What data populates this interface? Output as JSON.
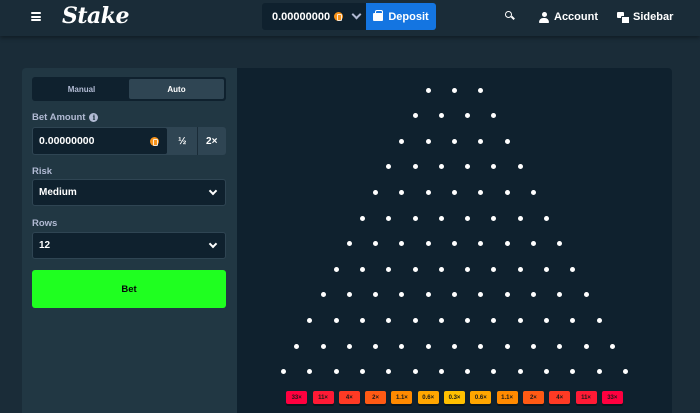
{
  "header": {
    "logo": "Stake",
    "balance": "0.00000000",
    "deposit_label": "Deposit",
    "account_label": "Account",
    "sidebar_label": "Sidebar",
    "icons": [
      "menu-icon",
      "coin-icon",
      "chevron-down-icon",
      "wallet-icon",
      "search-icon",
      "user-icon",
      "chat-icon"
    ]
  },
  "controls": {
    "tabs": [
      {
        "label": "Manual",
        "active": false
      },
      {
        "label": "Auto",
        "active": true
      }
    ],
    "bet_amount_label": "Bet Amount",
    "bet_amount_value": "0.00000000",
    "half_label": "½",
    "double_label": "2×",
    "risk_label": "Risk",
    "risk_value": "Medium",
    "rows_label": "Rows",
    "rows_value": "12",
    "bet_button_label": "Bet"
  },
  "board": {
    "rows": 12,
    "multipliers": [
      "33×",
      "11×",
      "4×",
      "2×",
      "1.1×",
      "0.6×",
      "0.3×",
      "0.6×",
      "1.1×",
      "2×",
      "4×",
      "11×",
      "33×"
    ],
    "bucket_colors": [
      "#ff003f",
      "#ff1a35",
      "#ff3a24",
      "#ff5a14",
      "#ff8a00",
      "#ffa600",
      "#ffc000",
      "#ffa600",
      "#ff8a00",
      "#ff5a14",
      "#ff3a24",
      "#ff1a35",
      "#ff003f"
    ]
  },
  "colors": {
    "background": "#1a2c38",
    "panel": "#213743",
    "board": "#0f212e",
    "deposit": "#1475e1",
    "bet_button": "#1fff20"
  }
}
